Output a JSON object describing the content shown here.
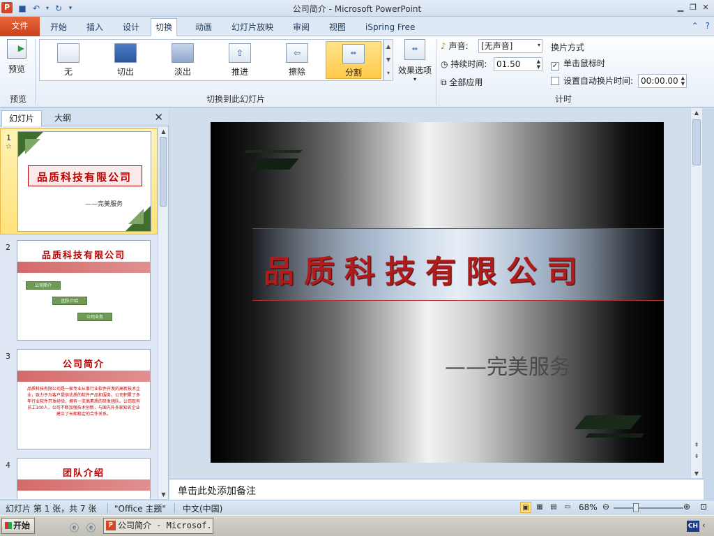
{
  "window": {
    "title": "公司简介 - Microsoft PowerPoint",
    "app_icon": "P"
  },
  "qat": {
    "save_icon": "save-icon",
    "undo_icon": "undo-icon",
    "redo_icon": "redo-icon"
  },
  "tabs": [
    {
      "label": "文件"
    },
    {
      "label": "开始"
    },
    {
      "label": "插入"
    },
    {
      "label": "设计"
    },
    {
      "label": "切换"
    },
    {
      "label": "动画"
    },
    {
      "label": "幻灯片放映"
    },
    {
      "label": "审阅"
    },
    {
      "label": "视图"
    },
    {
      "label": "iSpring Free"
    }
  ],
  "ribbon": {
    "preview": {
      "label": "预览",
      "group_label": "预览"
    },
    "transitions": {
      "group_label": "切换到此幻灯片",
      "items": [
        {
          "label": "无"
        },
        {
          "label": "切出"
        },
        {
          "label": "淡出"
        },
        {
          "label": "推进"
        },
        {
          "label": "擦除"
        },
        {
          "label": "分割"
        }
      ],
      "effect_options": "效果选项"
    },
    "timing": {
      "group_label": "计时",
      "sound_label": "声音:",
      "sound_value": "[无声音]",
      "duration_label": "持续时间:",
      "duration_value": "01.50",
      "apply_all": "全部应用",
      "advance_title": "换片方式",
      "on_click": "单击鼠标时",
      "after_time": "设置自动换片时间:",
      "after_value": "00:00.00"
    }
  },
  "left_pane": {
    "tab_slides": "幻灯片",
    "tab_outline": "大纲",
    "close": "✕",
    "slides": [
      {
        "num": "1",
        "star": "☆",
        "title": "品质科技有限公司",
        "subtitle": "——完美服务"
      },
      {
        "num": "2",
        "title": "品质科技有限公司",
        "boxes": [
          "公司简介",
          "团队介绍",
          "公司业务"
        ]
      },
      {
        "num": "3",
        "title": "公司简介",
        "body": "品质科技有限公司是一家专业从事行业软件开发的高新技术企业，致力于为客户提供优质的软件产品和服务。公司积累了多年行业软件开发经验，拥有一支高素质的研发团队。公司现有员工100人，公司不断加强技术创新，与国内外多家知名企业建立了长期稳定的合作关系。"
      },
      {
        "num": "4",
        "title": "团队介绍"
      }
    ]
  },
  "slide": {
    "title": "品质科技有限公司",
    "subtitle": "——完美服务"
  },
  "notes": {
    "placeholder": "单击此处添加备注"
  },
  "status": {
    "slide_info": "幻灯片 第 1 张，共 7 张",
    "theme": "\"Office 主题\"",
    "language": "中文(中国)",
    "zoom": "68%"
  },
  "taskbar": {
    "start": "开始",
    "task": "公司简介 - Microsof...",
    "ime": "CH"
  },
  "colors": {
    "accent_file_tab": "#d24726",
    "title_red": "#b01c1c",
    "selected_gold": "#ffe27a"
  }
}
